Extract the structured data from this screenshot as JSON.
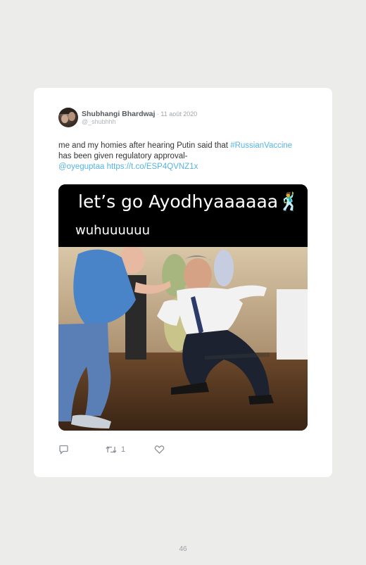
{
  "tweet": {
    "author_name": "Shubhangi Bhardwaj",
    "date": " · 11 août 2020",
    "handle": "@_shubhhh",
    "text_part1": "me and my homies after hearing Putin said that ",
    "hashtag": "#RussianVaccine",
    "text_part2": " has been given regulatory approval-",
    "mention": "@oyeguptaa",
    "url": "https://t.co/ESP4QVNZ1x"
  },
  "media": {
    "caption_line1": "let’s go Ayodhyaaaaaa",
    "caption_emoji": "🕺",
    "caption_line2": "wuhuuuuuu"
  },
  "actions": {
    "reply_icon": "reply-icon",
    "retweet_icon": "retweet-icon",
    "retweet_count": "1",
    "like_icon": "heart-icon"
  },
  "page": {
    "number": "46"
  },
  "colors": {
    "background": "#ececea",
    "card": "#ffffff",
    "link": "#55b3e6",
    "meme_band": "#000000"
  }
}
